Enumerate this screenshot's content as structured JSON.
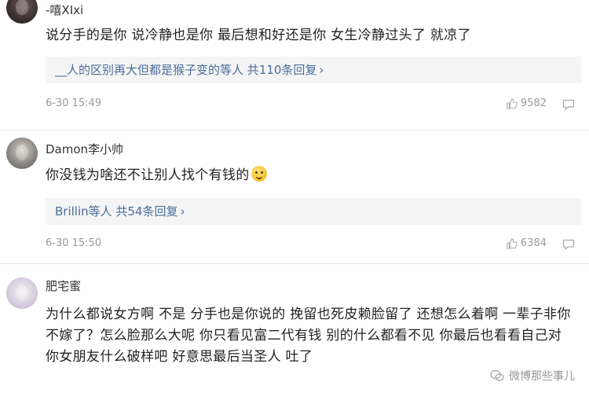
{
  "comments": [
    {
      "username": "-嘻XIxi",
      "content": "说分手的是你 说冷静也是你 最后想和好还是你 女生冷静过头了 就凉了",
      "reply_user": "__人的区别再大但都是猴子变的等人",
      "reply_count": "共110条回复",
      "timestamp": "6-30 15:49",
      "likes": "9582"
    },
    {
      "username": "Damon李小帅",
      "content": "你没钱为啥还不让别人找个有钱的",
      "reply_user": "Brillin等人",
      "reply_count": "共54条回复",
      "timestamp": "6-30 15:50",
      "likes": "6384"
    },
    {
      "username": "肥宅蜜",
      "content": "为什么都说女方啊 不是 分手也是你说的 挽留也死皮赖脸留了 还想怎么着啊 一辈子非你不嫁了？怎么脸那么大呢 你只看见富二代有钱 别的什么都看不见 你最后也看看自己对你女朋友什么破样吧 好意思最后当圣人 吐了"
    }
  ],
  "icons": {
    "like": "thumbs-up-icon",
    "reply": "comment-icon",
    "chevron": "chevron-right-icon",
    "watermark": "wechat-icon"
  },
  "watermark": "微博那些事儿",
  "colors": {
    "link": "#4a6d9a",
    "meta": "#999999",
    "reply_bg": "#f5f5f5"
  }
}
